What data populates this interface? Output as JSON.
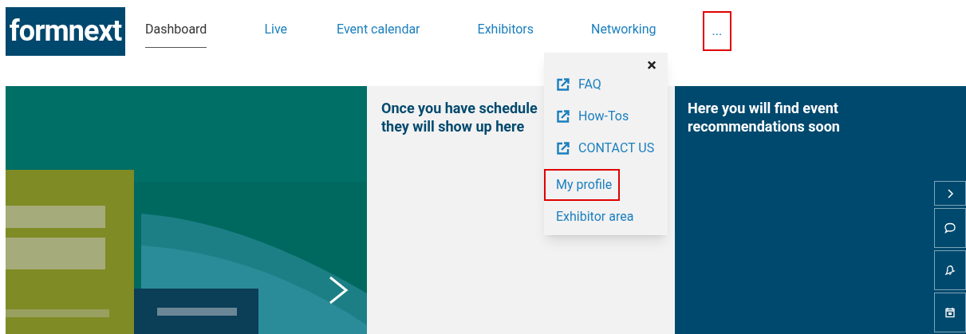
{
  "logo": "formnext",
  "nav": [
    {
      "label": "Dashboard",
      "selected": true,
      "highlighted": false
    },
    {
      "label": "Live",
      "selected": false,
      "highlighted": false
    },
    {
      "label": "Event calendar",
      "selected": false,
      "highlighted": false
    },
    {
      "label": "Exhibitors",
      "selected": false,
      "highlighted": false
    },
    {
      "label": "Networking",
      "selected": false,
      "highlighted": false
    },
    {
      "label": "...",
      "selected": false,
      "highlighted": true
    }
  ],
  "menu": {
    "close": "×",
    "items": [
      {
        "label": "FAQ",
        "kind": "external",
        "highlighted": false
      },
      {
        "label": "How-Tos",
        "kind": "external",
        "highlighted": false
      },
      {
        "label": "CONTACT US",
        "kind": "external",
        "highlighted": false
      },
      {
        "label": "My profile",
        "kind": "internal",
        "highlighted": true
      },
      {
        "label": "Exhibitor area",
        "kind": "internal",
        "highlighted": false
      }
    ]
  },
  "schedule_card": {
    "lines": [
      "Once you have schedule",
      "they will show up here"
    ]
  },
  "recommendations_card": {
    "title": "Here you will find event recommendations soon"
  },
  "side_buttons": [
    {
      "kind": "next"
    },
    {
      "kind": "chat"
    },
    {
      "kind": "bell"
    },
    {
      "kind": "calendar"
    }
  ]
}
